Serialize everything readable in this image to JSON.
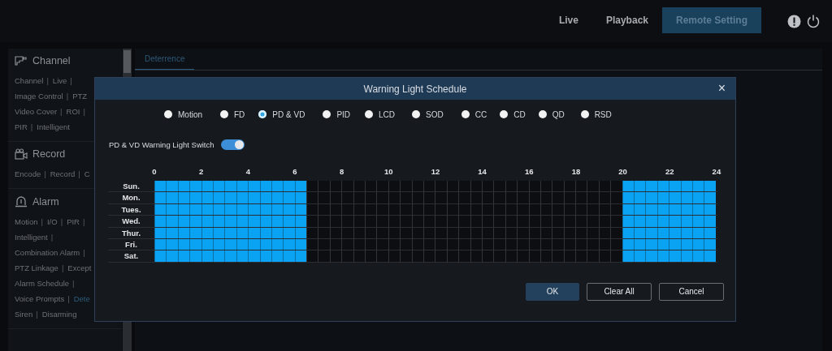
{
  "top_nav": {
    "tabs": [
      {
        "label": "Live",
        "selected": false
      },
      {
        "label": "Playback",
        "selected": false
      },
      {
        "label": "Remote Setting",
        "selected": true
      }
    ]
  },
  "sidebar": {
    "sections": [
      {
        "kind": "channel",
        "title": "Channel",
        "rows": [
          [
            {
              "label": "Channel",
              "separator": "|",
              "selected": false
            },
            {
              "label": "Live",
              "separator": "|",
              "selected": false
            }
          ],
          [
            {
              "label": "Image Control",
              "separator": "|",
              "selected": false
            },
            {
              "label": "PTZ",
              "selected": false
            }
          ],
          [
            {
              "label": "Video Cover",
              "separator": "|",
              "selected": false
            },
            {
              "label": "ROI",
              "separator": "|",
              "selected": false
            }
          ],
          [
            {
              "label": "PIR",
              "separator": "|",
              "selected": false
            },
            {
              "label": "Intelligent",
              "selected": false
            }
          ]
        ]
      },
      {
        "kind": "record",
        "title": "Record",
        "rows": [
          [
            {
              "label": "Encode",
              "separator": "|",
              "selected": false
            },
            {
              "label": "Record",
              "separator": "|",
              "selected": false
            },
            {
              "label": "C",
              "selected": false
            }
          ]
        ]
      },
      {
        "kind": "alarm",
        "title": "Alarm",
        "rows": [
          [
            {
              "label": "Motion",
              "separator": "|",
              "selected": false
            },
            {
              "label": "I/O",
              "separator": "|",
              "selected": false
            },
            {
              "label": "PIR",
              "separator": "|",
              "selected": false
            }
          ],
          [
            {
              "label": "Intelligent",
              "separator": "|",
              "selected": false
            }
          ],
          [
            {
              "label": "Combination Alarm",
              "separator": "|",
              "selected": false
            }
          ],
          [
            {
              "label": "PTZ Linkage",
              "separator": "|",
              "selected": false
            },
            {
              "label": "Except",
              "selected": false
            }
          ],
          [
            {
              "label": "Alarm Schedule",
              "separator": "|",
              "selected": false
            }
          ],
          [
            {
              "label": "Voice Prompts",
              "separator": "|",
              "selected": false
            },
            {
              "label": "Dete",
              "selected": true
            }
          ],
          [
            {
              "label": "Siren",
              "separator": "|",
              "selected": false
            },
            {
              "label": "Disarming",
              "selected": false
            }
          ]
        ]
      }
    ]
  },
  "content": {
    "tabs": [
      {
        "label": "Deterrence",
        "selected": true
      }
    ]
  },
  "dialog": {
    "title": "Warning Light Schedule",
    "close": "×",
    "detection_types": [
      {
        "label": "Motion",
        "selected": false
      },
      {
        "label": "FD",
        "selected": false
      },
      {
        "label": "PD & VD",
        "selected": true
      },
      {
        "label": "PID",
        "selected": false
      },
      {
        "label": "LCD",
        "selected": false
      },
      {
        "label": "SOD",
        "selected": false
      },
      {
        "label": "CC",
        "selected": false
      },
      {
        "label": "CD",
        "selected": false
      },
      {
        "label": "QD",
        "selected": false
      },
      {
        "label": "RSD",
        "selected": false
      }
    ],
    "switch": {
      "label": "PD & VD Warning Light Switch",
      "on": true
    },
    "schedule": {
      "hours": [
        "0",
        "2",
        "4",
        "6",
        "8",
        "10",
        "12",
        "14",
        "16",
        "18",
        "20",
        "22",
        "24"
      ],
      "days": [
        {
          "label": "Sun.",
          "cells": [
            true,
            true,
            true,
            true,
            true,
            true,
            true,
            true,
            true,
            true,
            true,
            true,
            true,
            false,
            false,
            false,
            false,
            false,
            false,
            false,
            false,
            false,
            false,
            false,
            false,
            false,
            false,
            false,
            false,
            false,
            false,
            false,
            false,
            false,
            false,
            false,
            false,
            false,
            false,
            false,
            true,
            true,
            true,
            true,
            true,
            true,
            true,
            true
          ]
        },
        {
          "label": "Mon.",
          "cells": [
            true,
            true,
            true,
            true,
            true,
            true,
            true,
            true,
            true,
            true,
            true,
            true,
            true,
            false,
            false,
            false,
            false,
            false,
            false,
            false,
            false,
            false,
            false,
            false,
            false,
            false,
            false,
            false,
            false,
            false,
            false,
            false,
            false,
            false,
            false,
            false,
            false,
            false,
            false,
            false,
            true,
            true,
            true,
            true,
            true,
            true,
            true,
            true
          ]
        },
        {
          "label": "Tues.",
          "cells": [
            true,
            true,
            true,
            true,
            true,
            true,
            true,
            true,
            true,
            true,
            true,
            true,
            true,
            false,
            false,
            false,
            false,
            false,
            false,
            false,
            false,
            false,
            false,
            false,
            false,
            false,
            false,
            false,
            false,
            false,
            false,
            false,
            false,
            false,
            false,
            false,
            false,
            false,
            false,
            false,
            true,
            true,
            true,
            true,
            true,
            true,
            true,
            true
          ]
        },
        {
          "label": "Wed.",
          "cells": [
            true,
            true,
            true,
            true,
            true,
            true,
            true,
            true,
            true,
            true,
            true,
            true,
            true,
            false,
            false,
            false,
            false,
            false,
            false,
            false,
            false,
            false,
            false,
            false,
            false,
            false,
            false,
            false,
            false,
            false,
            false,
            false,
            false,
            false,
            false,
            false,
            false,
            false,
            false,
            false,
            true,
            true,
            true,
            true,
            true,
            true,
            true,
            true
          ]
        },
        {
          "label": "Thur.",
          "cells": [
            true,
            true,
            true,
            true,
            true,
            true,
            true,
            true,
            true,
            true,
            true,
            true,
            true,
            false,
            false,
            false,
            false,
            false,
            false,
            false,
            false,
            false,
            false,
            false,
            false,
            false,
            false,
            false,
            false,
            false,
            false,
            false,
            false,
            false,
            false,
            false,
            false,
            false,
            false,
            false,
            true,
            true,
            true,
            true,
            true,
            true,
            true,
            true
          ]
        },
        {
          "label": "Fri.",
          "cells": [
            true,
            true,
            true,
            true,
            true,
            true,
            true,
            true,
            true,
            true,
            true,
            true,
            true,
            false,
            false,
            false,
            false,
            false,
            false,
            false,
            false,
            false,
            false,
            false,
            false,
            false,
            false,
            false,
            false,
            false,
            false,
            false,
            false,
            false,
            false,
            false,
            false,
            false,
            false,
            false,
            true,
            true,
            true,
            true,
            true,
            true,
            true,
            true
          ]
        },
        {
          "label": "Sat.",
          "cells": [
            true,
            true,
            true,
            true,
            true,
            true,
            true,
            true,
            true,
            true,
            true,
            true,
            true,
            false,
            false,
            false,
            false,
            false,
            false,
            false,
            false,
            false,
            false,
            false,
            false,
            false,
            false,
            false,
            false,
            false,
            false,
            false,
            false,
            false,
            false,
            false,
            false,
            false,
            false,
            false,
            true,
            true,
            true,
            true,
            true,
            true,
            true,
            true
          ]
        }
      ]
    },
    "buttons": [
      {
        "label": "OK",
        "kind": "primary"
      },
      {
        "label": "Clear All",
        "kind": "outline"
      },
      {
        "label": "Cancel",
        "kind": "outline"
      }
    ]
  }
}
